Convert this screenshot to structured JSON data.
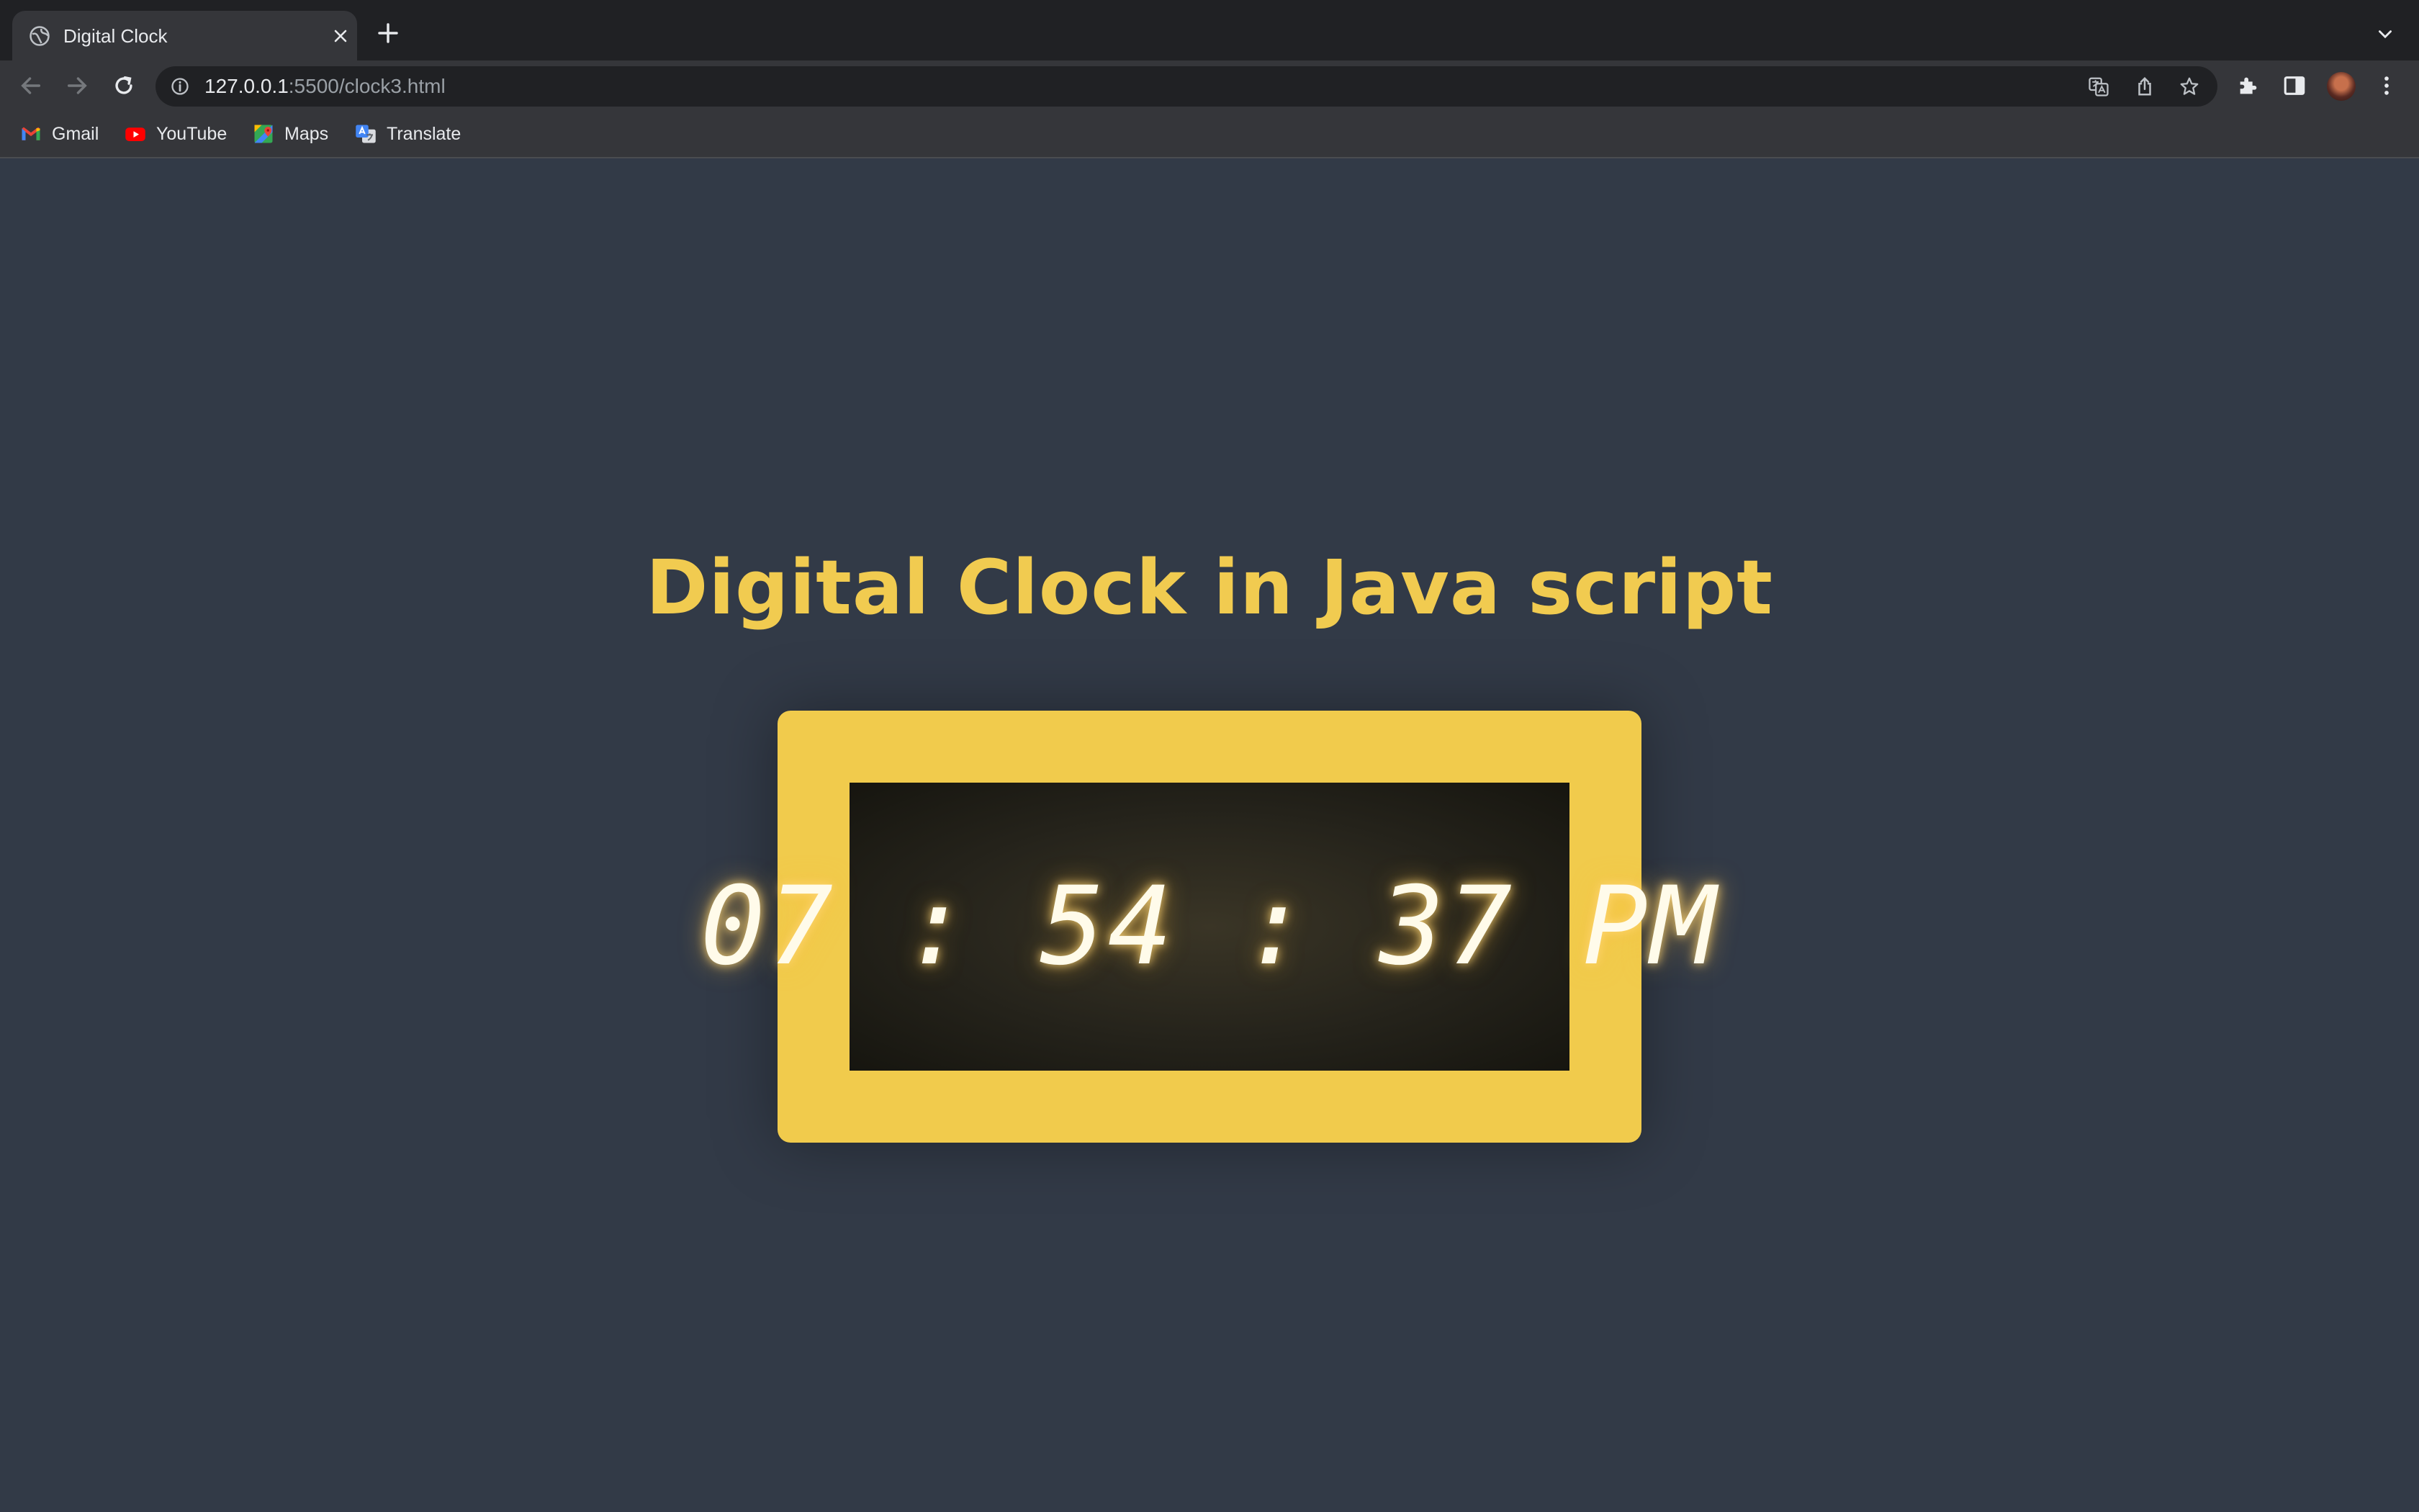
{
  "browser": {
    "tab": {
      "title": "Digital Clock"
    },
    "url": {
      "host": "127.0.0.1",
      "rest": ":5500/clock3.html"
    },
    "bookmarks": [
      {
        "label": "Gmail",
        "icon": "gmail-icon"
      },
      {
        "label": "YouTube",
        "icon": "youtube-icon"
      },
      {
        "label": "Maps",
        "icon": "maps-icon"
      },
      {
        "label": "Translate",
        "icon": "translate-icon"
      }
    ]
  },
  "page": {
    "heading": "Digital Clock in Java script",
    "clock": {
      "time": "07 : 54 : 37 PM"
    }
  },
  "colors": {
    "background": "#323a47",
    "accent": "#f1cb4c",
    "display": "#fffbea"
  }
}
